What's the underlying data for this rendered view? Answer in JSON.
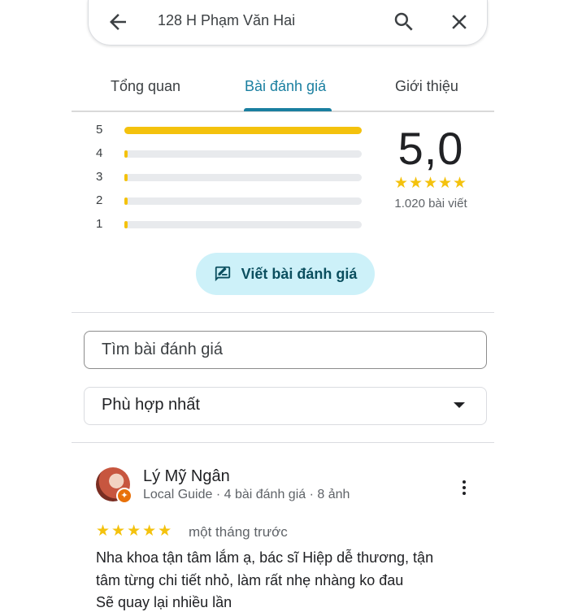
{
  "search": {
    "query": "128 H Phạm Văn Hai"
  },
  "icons": {
    "back": "arrow-back-icon",
    "search": "search-icon",
    "close": "close-icon",
    "write": "rate-review-icon",
    "dropdown": "dropdown-arrow-icon",
    "more": "more-vert-icon"
  },
  "tabs": [
    {
      "label": "Tổng quan",
      "active": false
    },
    {
      "label": "Bài đánh giá",
      "active": true
    },
    {
      "label": "Giới thiệu",
      "active": false
    }
  ],
  "rating_summary": {
    "value": "5,0",
    "stars": "★★★★★",
    "count_text": "1.020 bài viết",
    "histogram": [
      {
        "label": "5",
        "fraction": 1.0
      },
      {
        "label": "4",
        "fraction": 0.006
      },
      {
        "label": "3",
        "fraction": 0.006
      },
      {
        "label": "2",
        "fraction": 0.006
      },
      {
        "label": "1",
        "fraction": 0.006
      }
    ]
  },
  "write_review": {
    "label": "Viết bài đánh giá"
  },
  "review_search": {
    "placeholder": "Tìm bài đánh giá"
  },
  "sort": {
    "selected": "Phù hợp nhất"
  },
  "reviews": [
    {
      "name": "Lý Mỹ Ngân",
      "meta": "Local Guide · 4 bài đánh giá · 8 ảnh",
      "stars": "★★★★★",
      "time": "một tháng trước",
      "text_lines": [
        "Nha khoa tận tâm lắm ạ, bác sĩ Hiệp dễ thương, tận",
        "tâm từng chi tiết nhỏ, làm rất nhẹ nhàng ko đau",
        "Sẽ quay lại nhiều lần"
      ]
    }
  ],
  "colors": {
    "accent": "#1a7fa0",
    "star": "#f4c20d",
    "button_bg": "#cdf1f9"
  }
}
